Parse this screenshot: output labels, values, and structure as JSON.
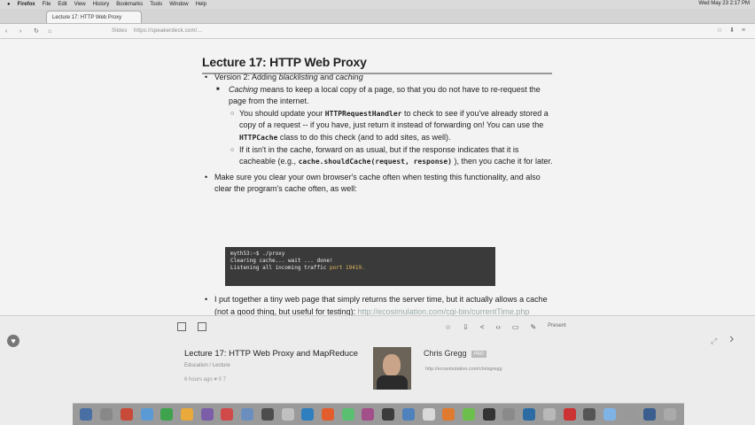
{
  "menubar": {
    "app": "Firefox",
    "items": [
      "File",
      "Edit",
      "View",
      "History",
      "Bookmarks",
      "Tools",
      "Window",
      "Help"
    ],
    "clock": "Wed May 23 2:17 PM"
  },
  "tabs": [
    {
      "label": "Lecture 17: HTTP Web Proxy",
      "active": true
    }
  ],
  "addressbar": {
    "url_prefix": "Slides",
    "url": "https://speakerdeck.com/..."
  },
  "slide": {
    "title": "Lecture 17: HTTP Web Proxy",
    "version_line": "Version 2: Adding",
    "version_em1": "blacklisting",
    "version_and": "and",
    "version_em2": "caching",
    "caching_em": "Caching",
    "caching_text": "means to keep a local copy of a page, so that you do not have to re-request the page from the internet.",
    "s1_a": "You should update your",
    "s1_code": "HTTPRequestHandler",
    "s1_b": "to check to see if you've already stored a copy of a request -- if you have, just return it instead of forwarding on! You can use the",
    "s1_code2": "HTTPCache",
    "s1_c": "class to do this check (and to add sites, as well).",
    "s2_a": "If it isn't in the cache, forward on as usual, but if the response indicates that it is cacheable (e.g.,",
    "s2_code": "cache.shouldCache(request, response)",
    "s2_b": "), then you cache it for later.",
    "b2": "Make sure you clear your own browser's cache often when testing this functionality, and also clear the program's cache often, as well:",
    "terminal": {
      "line1": "myth53:~$ ./proxy",
      "line2": "Clearing        cache... wait         ... done!",
      "line3a": "Listening       all incoming traffic     ",
      "line3b": "port 19419."
    },
    "b3_text": "I put together a tiny web page that simply returns the server time, but it actually allows a cache (not a good thing, but useful for testing):",
    "b3_link": "http://ecosimulation.com/cgi-bin/currentTime.php"
  },
  "controls": {
    "present": "Present"
  },
  "presentation": {
    "title": "Lecture 17: HTTP Web Proxy and MapReduce",
    "subtitle": "Education / Lecture",
    "stats": "6 hours ago   ♥ 0   7",
    "author": "Chris Gregg",
    "author_badge": "PRO",
    "author_url": "http://ecosimulation.com/chrisgregg"
  },
  "dock_colors": [
    "#4a6fa5",
    "#888888",
    "#c84b3a",
    "#5a9bd5",
    "#3fa34d",
    "#e9a93b",
    "#7b5ea7",
    "#d04a4a",
    "#6a8fbf",
    "#4d4d4d",
    "#c0c0c0",
    "#2f7fbf",
    "#e35d2c",
    "#5bbf72",
    "#a34f8a",
    "#3c3c3c",
    "#4f81bd",
    "#d9d9d9",
    "#e07a2e",
    "#6dbf4d",
    "#333333",
    "#8a8a8a",
    "#2d6ca2",
    "#b8b8b8",
    "#c33",
    "#555555",
    "#7fb2e5",
    "#999999",
    "#3a5f8f",
    "#aaaaaa"
  ]
}
